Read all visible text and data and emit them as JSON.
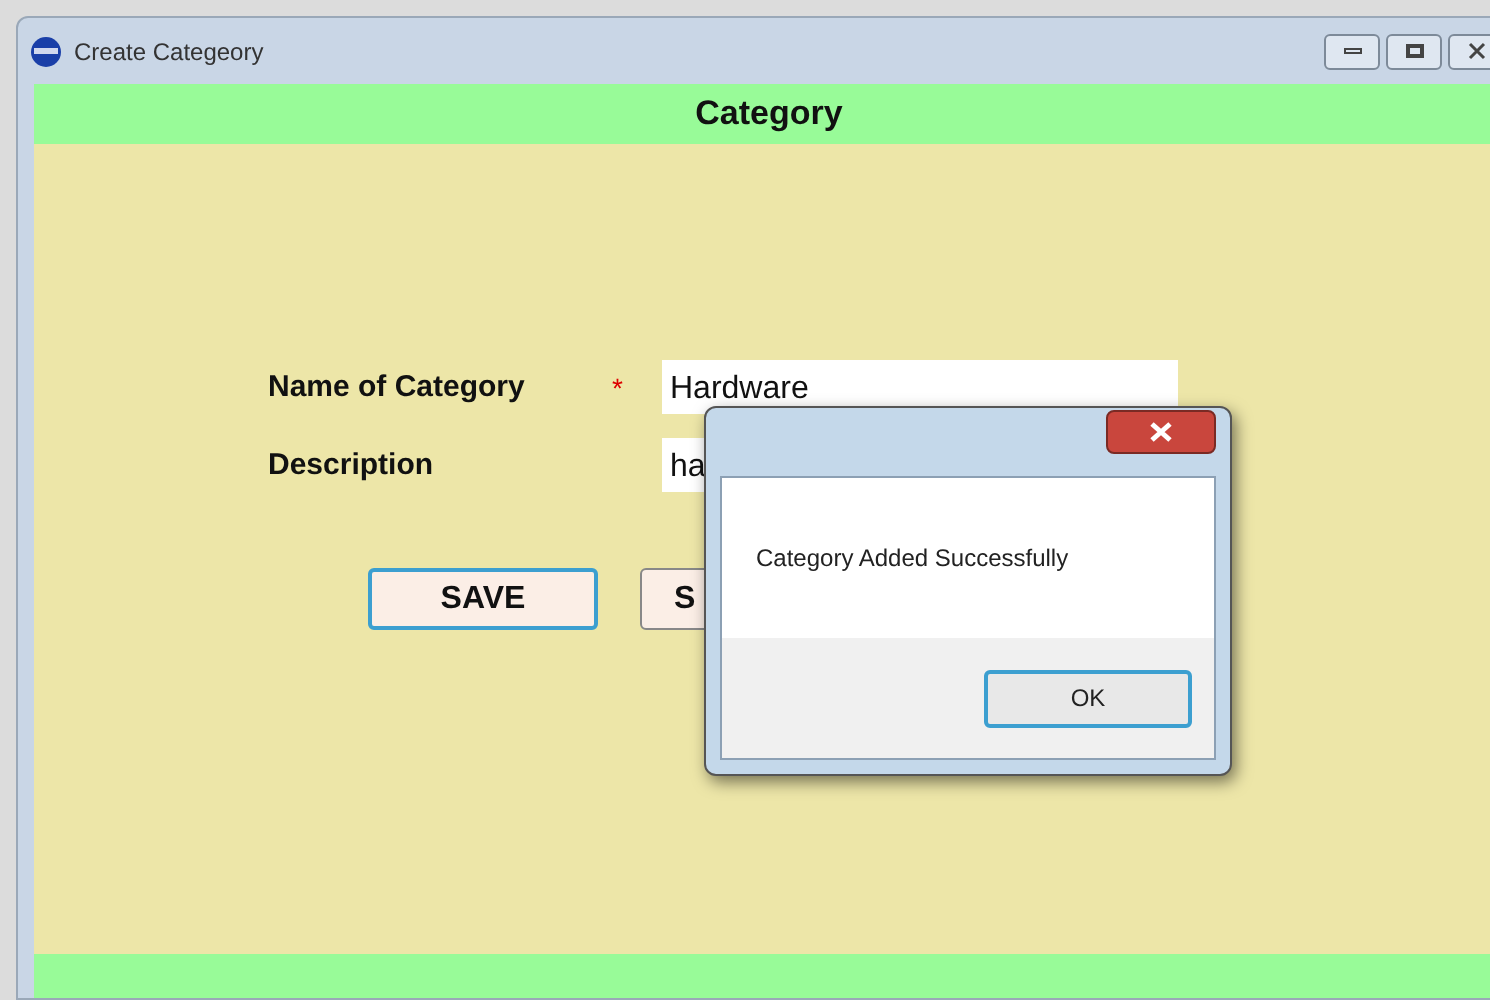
{
  "window": {
    "title": "Create Categeory"
  },
  "header": {
    "title": "Category"
  },
  "form": {
    "fields": [
      {
        "label": "Name of Category",
        "marker": "*",
        "value": "Hardware"
      },
      {
        "label": "Description",
        "value": "ha"
      }
    ],
    "buttons": [
      "SAVE",
      "S"
    ]
  },
  "dialog": {
    "message": "Category Added Successfully",
    "button": "OK"
  }
}
